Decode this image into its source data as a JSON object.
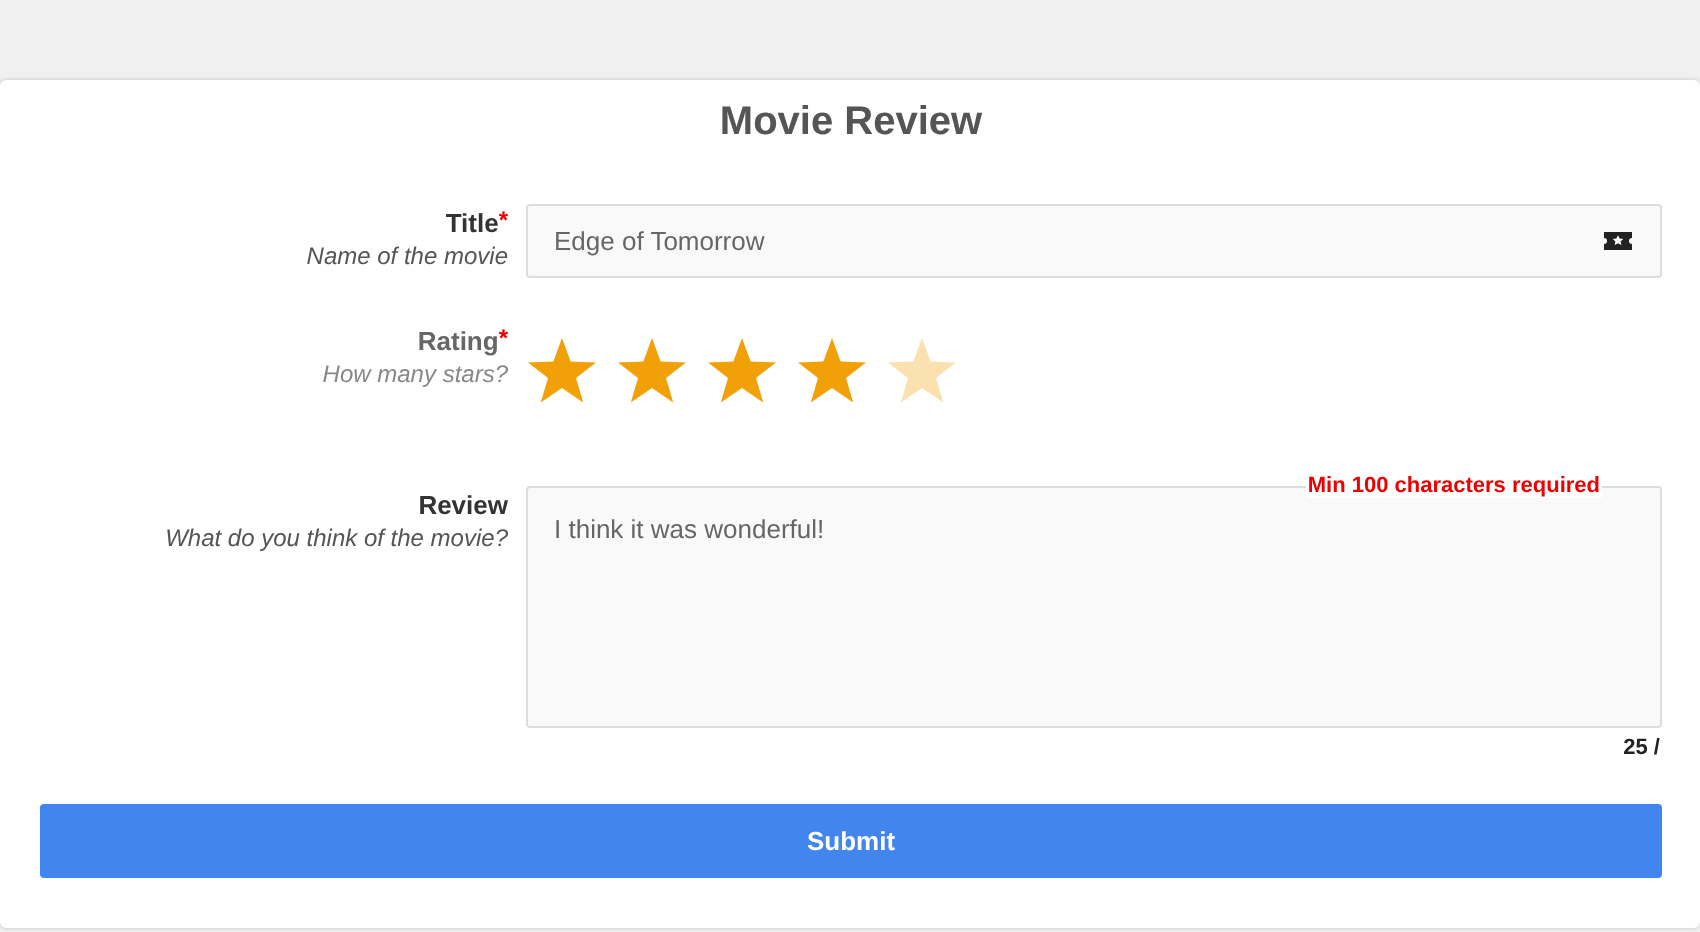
{
  "form": {
    "title": "Movie Review"
  },
  "fields": [
    {
      "kind": "input",
      "label": "Title",
      "required_mark": "*",
      "hint": "Name of the movie",
      "value": "Edge of Tomorrow"
    },
    {
      "kind": "stars",
      "label": "Rating",
      "required_mark": "*",
      "hint": "How many stars?",
      "stars": 4
    },
    {
      "kind": "textarea",
      "label": "Review",
      "hint": "What do you think of the movie?",
      "value": "I think it was wonderful!",
      "error": "Min 100 characters required",
      "counter": "25 /"
    }
  ],
  "submit": "Submit"
}
